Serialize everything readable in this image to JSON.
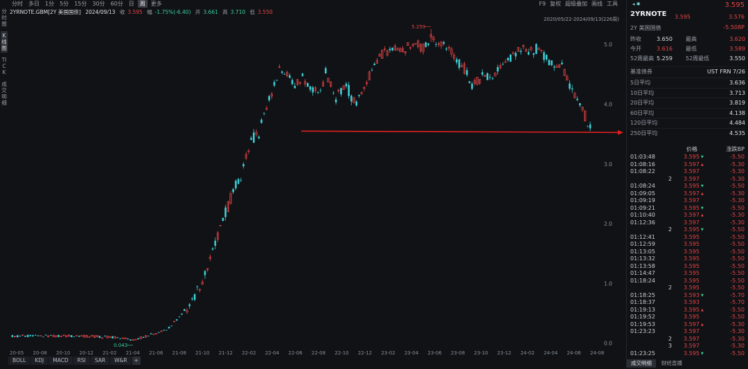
{
  "left_tabs": [
    "分时图",
    "K线图",
    "TICK",
    "成交明细"
  ],
  "timeframes": {
    "items": [
      "分时",
      "多日",
      "1分",
      "5分",
      "15分",
      "30分",
      "60分",
      "日",
      "周",
      "更多"
    ],
    "active": "周"
  },
  "toolbar_right": [
    "F9",
    "复权",
    "超级叠加",
    "画线",
    "工具"
  ],
  "info": {
    "symbol": "2YRNOTE.GBM[2Y 美国国债]",
    "date": "2024/09/13",
    "close_label": "收",
    "close": "3.595",
    "change_label": "幅",
    "change": "-1.75%(-6.40)",
    "open_label": "开",
    "open": "3.661",
    "high_label": "高",
    "high": "3.710",
    "low_label": "低",
    "low": "3.550"
  },
  "date_range": "2020/05/22-2024/09/13(226周)",
  "chart_data": {
    "type": "candlestick",
    "period": "weekly",
    "y_ticks": [
      0.0,
      1.0,
      2.0,
      3.0,
      4.0,
      5.0
    ],
    "ylim": [
      -0.05,
      5.35
    ],
    "x_ticks": [
      "20-05",
      "20-08",
      "20-10",
      "20-12",
      "21-02",
      "21-04",
      "21-06",
      "21-08",
      "21-10",
      "21-12",
      "22-02",
      "22-04",
      "22-06",
      "22-08",
      "22-10",
      "22-12",
      "23-02",
      "23-04",
      "23-06",
      "23-08",
      "23-10",
      "23-12",
      "24-02",
      "24-04",
      "24-06",
      "24-08"
    ],
    "x_range": [
      "2020/05/22",
      "2024/09/13"
    ],
    "annotations": [
      {
        "text": "5.259",
        "value": 5.259,
        "date": "2023-08"
      },
      {
        "text": "0.043",
        "value": 0.043,
        "date": "2021-04"
      }
    ],
    "reference_line": {
      "value": 3.55,
      "color": "#e02020"
    },
    "colors": {
      "up": "#e64545",
      "down": "#3ecfd6"
    }
  },
  "panel": {
    "title": "2YRNOTE",
    "top_price": "3.595",
    "mini_prices": [
      "3.595",
      "3.576"
    ],
    "subtitle": "2Y 美国国债",
    "change": "-5.508P",
    "stats": [
      {
        "l1": "昨收",
        "v1": "3.650",
        "l2": "最高",
        "v2": "3.620",
        "v2_color": "red"
      },
      {
        "l1": "今开",
        "v1": "3.616",
        "v1_color": "red",
        "l2": "最低",
        "v2": "3.589",
        "v2_color": "red"
      },
      {
        "l1": "52周最高",
        "v1": "5.259",
        "l2": "52周最低",
        "v2": "3.550"
      }
    ],
    "base": {
      "label": "基准债券",
      "value": "UST FRN 7/26"
    },
    "ma": [
      {
        "k": "5日平均",
        "v": "3.636"
      },
      {
        "k": "10日平均",
        "v": "3.713"
      },
      {
        "k": "20日平均",
        "v": "3.819"
      },
      {
        "k": "60日平均",
        "v": "4.138"
      },
      {
        "k": "120日平均",
        "v": "4.484"
      },
      {
        "k": "250日平均",
        "v": "4.535"
      }
    ],
    "trade_headers": {
      "price": "价格",
      "bp": "涨跌BP"
    },
    "trades": [
      {
        "t": "01:03:48",
        "p": "3.595",
        "f": "d",
        "b": "-5.50"
      },
      {
        "t": "01:08:16",
        "p": "3.597",
        "f": "u",
        "b": "-5.30"
      },
      {
        "t": "01:08:22",
        "p": "3.597",
        "f": "",
        "b": "-5.30"
      },
      {
        "t": "2",
        "p": "3.597",
        "f": "",
        "b": "-5.30"
      },
      {
        "t": "01:08:24",
        "p": "3.595",
        "f": "d",
        "b": "-5.50"
      },
      {
        "t": "01:09:05",
        "p": "3.597",
        "f": "u",
        "b": "-5.30"
      },
      {
        "t": "01:09:19",
        "p": "3.597",
        "f": "",
        "b": "-5.30"
      },
      {
        "t": "01:09:21",
        "p": "3.595",
        "f": "d",
        "b": "-5.50"
      },
      {
        "t": "01:10:40",
        "p": "3.597",
        "f": "u",
        "b": "-5.30"
      },
      {
        "t": "01:12:36",
        "p": "3.597",
        "f": "",
        "b": "-5.30"
      },
      {
        "t": "2",
        "p": "3.595",
        "f": "d",
        "b": "-5.50"
      },
      {
        "t": "01:12:41",
        "p": "3.595",
        "f": "",
        "b": "-5.50"
      },
      {
        "t": "01:12:59",
        "p": "3.595",
        "f": "",
        "b": "-5.50"
      },
      {
        "t": "01:13:05",
        "p": "3.595",
        "f": "",
        "b": "-5.50"
      },
      {
        "t": "01:13:32",
        "p": "3.595",
        "f": "",
        "b": "-5.50"
      },
      {
        "t": "01:13:58",
        "p": "3.595",
        "f": "",
        "b": "-5.50"
      },
      {
        "t": "01:14:47",
        "p": "3.595",
        "f": "",
        "b": "-5.50"
      },
      {
        "t": "01:18:24",
        "p": "3.595",
        "f": "",
        "b": "-5.50"
      },
      {
        "t": "2",
        "p": "3.595",
        "f": "",
        "b": "-5.50"
      },
      {
        "t": "01:18:25",
        "p": "3.593",
        "f": "d",
        "b": "-5.70"
      },
      {
        "t": "01:18:37",
        "p": "3.593",
        "f": "",
        "b": "-5.70"
      },
      {
        "t": "01:19:13",
        "p": "3.595",
        "f": "u",
        "b": "-5.50"
      },
      {
        "t": "01:19:52",
        "p": "3.595",
        "f": "",
        "b": "-5.50"
      },
      {
        "t": "01:19:53",
        "p": "3.597",
        "f": "u",
        "b": "-5.30"
      },
      {
        "t": "01:23:23",
        "p": "3.597",
        "f": "",
        "b": "-5.30"
      },
      {
        "t": "2",
        "p": "3.597",
        "f": "",
        "b": "-5.30"
      },
      {
        "t": "3",
        "p": "3.597",
        "f": "",
        "b": "-5.30"
      },
      {
        "t": "01:23:25",
        "p": "3.595",
        "f": "d",
        "b": "-5.50"
      }
    ],
    "bottom_tabs": {
      "items": [
        "成交明细",
        "财经直播"
      ],
      "active": "成交明细"
    }
  },
  "indicator_tabs": [
    "BOLL",
    "KDJ",
    "MACD",
    "RSI",
    "SAR",
    "W&R",
    "+"
  ]
}
